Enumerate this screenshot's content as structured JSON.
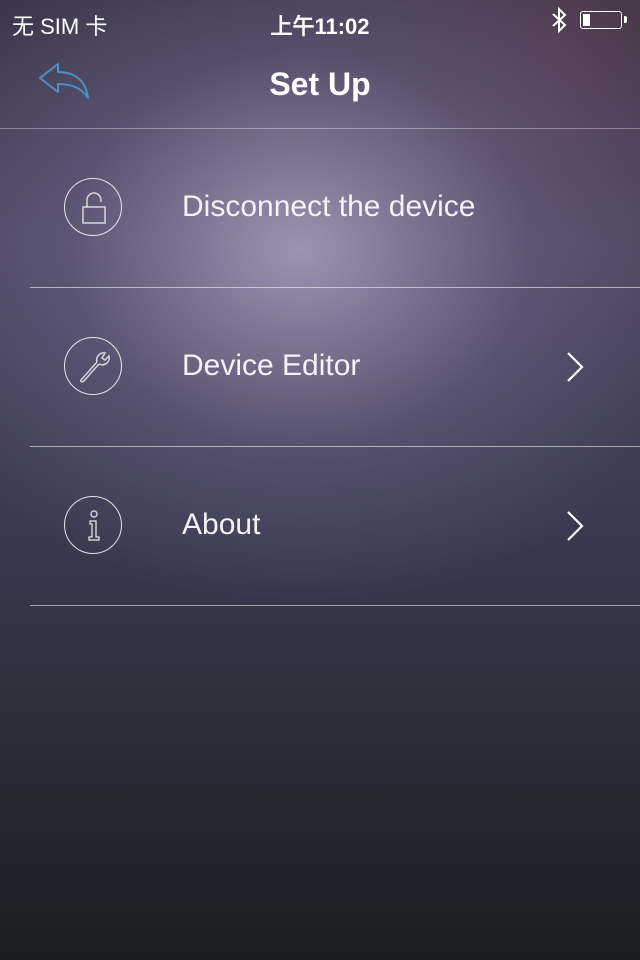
{
  "status_bar": {
    "carrier": "无 SIM 卡",
    "time": "上午11:02",
    "bluetooth_icon": "bluetooth-icon",
    "battery_level_percent": 20
  },
  "nav": {
    "back_icon": "reply-arrow-icon",
    "title": "Set Up"
  },
  "menu": {
    "items": [
      {
        "label": "Disconnect the device",
        "icon": "unlock-icon",
        "has_chevron": false
      },
      {
        "label": "Device Editor",
        "icon": "wrench-icon",
        "has_chevron": true
      },
      {
        "label": "About",
        "icon": "info-icon",
        "has_chevron": true
      }
    ]
  },
  "colors": {
    "accent_back_arrow": "#4e8fc0",
    "text": "#ffffff"
  }
}
